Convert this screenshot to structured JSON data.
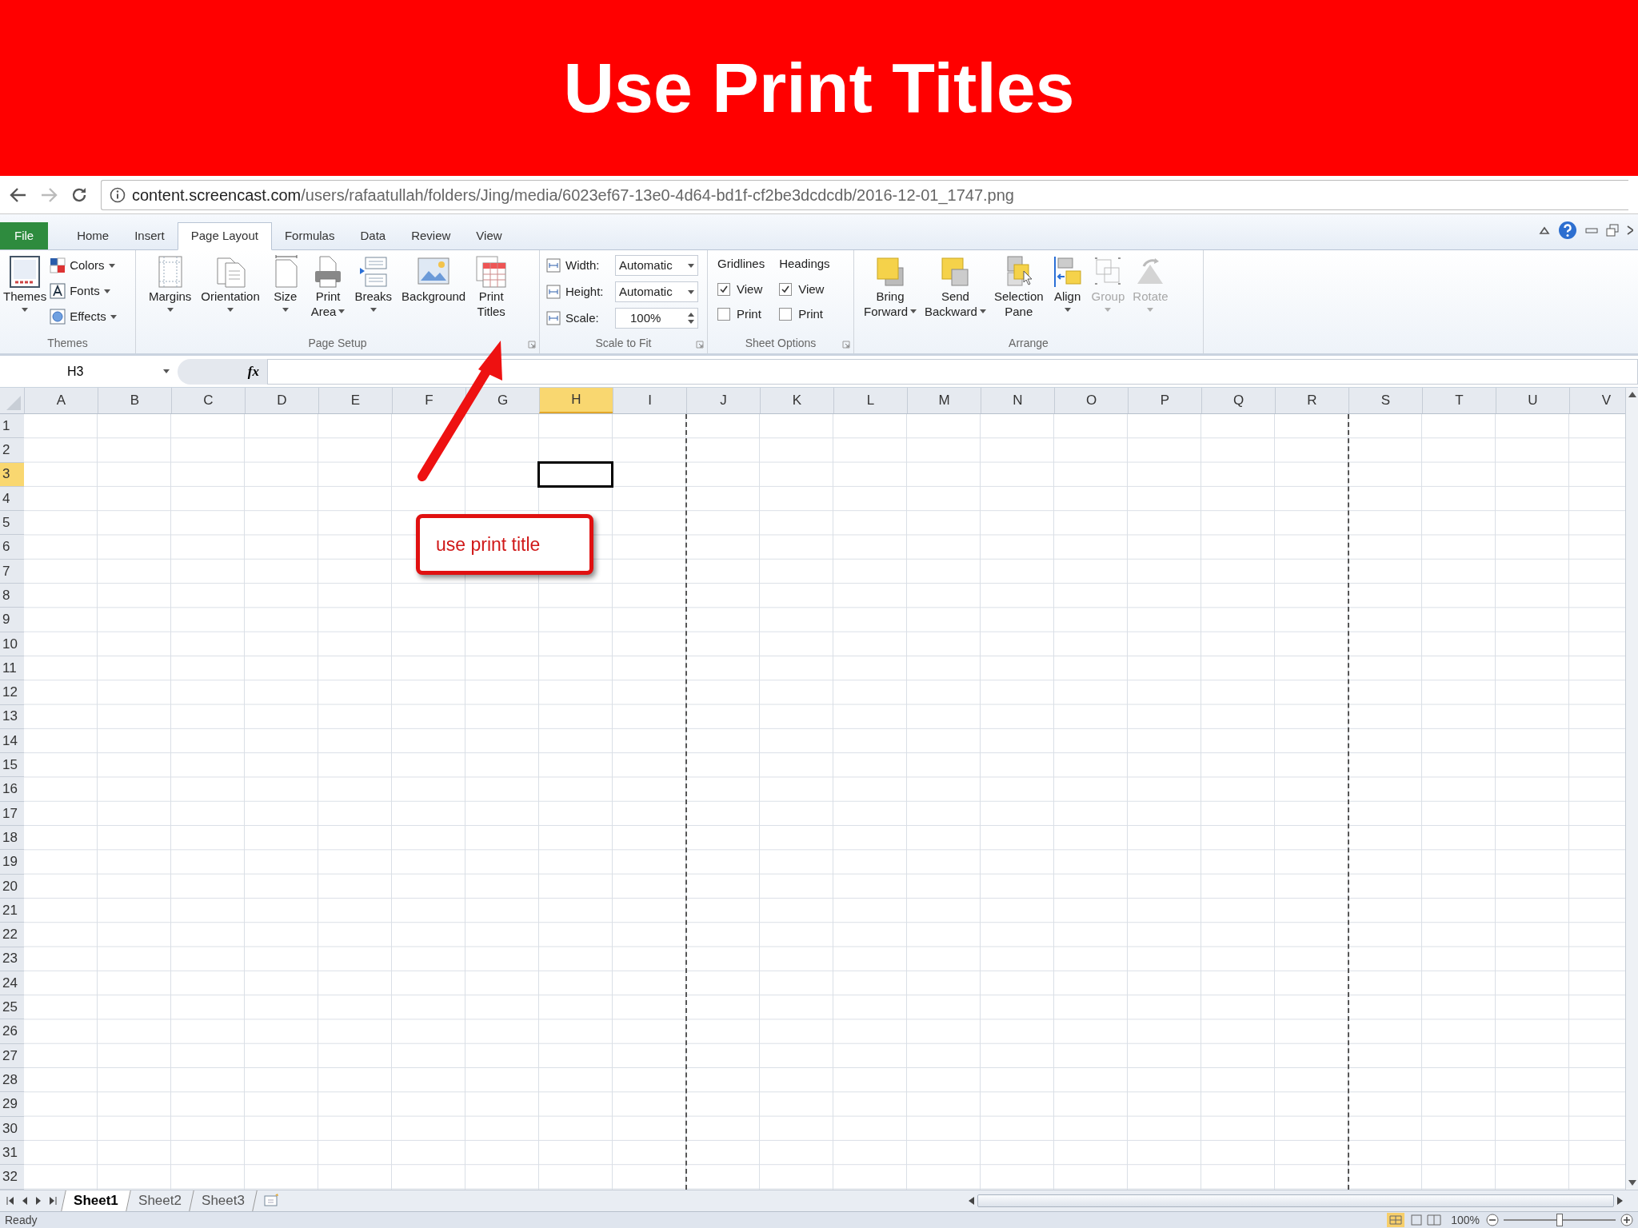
{
  "slide_title": "Use Print Titles",
  "browser": {
    "url_host": "content.screencast.com",
    "url_path": "/users/rafaatullah/folders/Jing/media/6023ef67-13e0-4d64-bd1f-cf2be3dcdcdb/2016-12-01_1747.png"
  },
  "ribbon_tabs": [
    {
      "label": "File",
      "kind": "file",
      "selected": false
    },
    {
      "label": "Home",
      "kind": "tab",
      "selected": false
    },
    {
      "label": "Insert",
      "kind": "tab",
      "selected": false
    },
    {
      "label": "Page Layout",
      "kind": "tab",
      "selected": true
    },
    {
      "label": "Formulas",
      "kind": "tab",
      "selected": false
    },
    {
      "label": "Data",
      "kind": "tab",
      "selected": false
    },
    {
      "label": "Review",
      "kind": "tab",
      "selected": false
    },
    {
      "label": "View",
      "kind": "tab",
      "selected": false
    }
  ],
  "themes_group": {
    "label": "Themes",
    "big_button": {
      "lines": [
        "Themes"
      ],
      "dropdown": true
    },
    "small_buttons": [
      {
        "label": "Colors",
        "dropdown": true
      },
      {
        "label": "Fonts",
        "dropdown": true
      },
      {
        "label": "Effects",
        "dropdown": true
      }
    ]
  },
  "page_setup_group": {
    "label": "Page Setup",
    "buttons": [
      {
        "lines": [
          "Margins"
        ],
        "dropdown": true
      },
      {
        "lines": [
          "Orientation"
        ],
        "dropdown": true
      },
      {
        "lines": [
          "Size"
        ],
        "dropdown": true
      },
      {
        "lines": [
          "Print",
          "Area"
        ],
        "dropdown": true
      },
      {
        "lines": [
          "Breaks"
        ],
        "dropdown": true
      },
      {
        "lines": [
          "Background"
        ],
        "dropdown": false
      },
      {
        "lines": [
          "Print",
          "Titles"
        ],
        "dropdown": false
      }
    ]
  },
  "scale_group": {
    "label": "Scale to Fit",
    "fields": [
      {
        "label": "Width:",
        "value": "Automatic",
        "kind": "dropdown"
      },
      {
        "label": "Height:",
        "value": "Automatic",
        "kind": "dropdown"
      },
      {
        "label": "Scale:",
        "value": "100%",
        "kind": "spinner"
      }
    ]
  },
  "sheet_options_group": {
    "label": "Sheet Options",
    "sections": [
      {
        "heading": "Gridlines",
        "options": [
          {
            "label": "View",
            "checked": true
          },
          {
            "label": "Print",
            "checked": false
          }
        ]
      },
      {
        "heading": "Headings",
        "options": [
          {
            "label": "View",
            "checked": true
          },
          {
            "label": "Print",
            "checked": false
          }
        ]
      }
    ]
  },
  "arrange_group": {
    "label": "Arrange",
    "buttons": [
      {
        "lines": [
          "Bring",
          "Forward"
        ],
        "dropdown": true,
        "disabled": false
      },
      {
        "lines": [
          "Send",
          "Backward"
        ],
        "dropdown": true,
        "disabled": false
      },
      {
        "lines": [
          "Selection",
          "Pane"
        ],
        "dropdown": false,
        "disabled": false
      },
      {
        "lines": [
          "Align"
        ],
        "dropdown": true,
        "disabled": false
      },
      {
        "lines": [
          "Group"
        ],
        "dropdown": true,
        "disabled": true
      },
      {
        "lines": [
          "Rotate"
        ],
        "dropdown": true,
        "disabled": true
      }
    ]
  },
  "formula_bar": {
    "name_box": "H3",
    "function_label": "fx"
  },
  "columns": [
    {
      "label": "A",
      "selected": false,
      "page_break": false
    },
    {
      "label": "B",
      "selected": false,
      "page_break": false
    },
    {
      "label": "C",
      "selected": false,
      "page_break": false
    },
    {
      "label": "D",
      "selected": false,
      "page_break": false
    },
    {
      "label": "E",
      "selected": false,
      "page_break": false
    },
    {
      "label": "F",
      "selected": false,
      "page_break": false
    },
    {
      "label": "G",
      "selected": false,
      "page_break": false
    },
    {
      "label": "H",
      "selected": true,
      "page_break": false
    },
    {
      "label": "I",
      "selected": false,
      "page_break": true
    },
    {
      "label": "J",
      "selected": false,
      "page_break": false
    },
    {
      "label": "K",
      "selected": false,
      "page_break": false
    },
    {
      "label": "L",
      "selected": false,
      "page_break": false
    },
    {
      "label": "M",
      "selected": false,
      "page_break": false
    },
    {
      "label": "N",
      "selected": false,
      "page_break": false
    },
    {
      "label": "O",
      "selected": false,
      "page_break": false
    },
    {
      "label": "P",
      "selected": false,
      "page_break": false
    },
    {
      "label": "Q",
      "selected": false,
      "page_break": false
    },
    {
      "label": "R",
      "selected": false,
      "page_break": true
    },
    {
      "label": "S",
      "selected": false,
      "page_break": false
    },
    {
      "label": "T",
      "selected": false,
      "page_break": false
    },
    {
      "label": "U",
      "selected": false,
      "page_break": false
    },
    {
      "label": "V",
      "selected": false,
      "page_break": false
    }
  ],
  "rows": [
    {
      "label": "1",
      "selected": false
    },
    {
      "label": "2",
      "selected": false
    },
    {
      "label": "3",
      "selected": true
    },
    {
      "label": "4",
      "selected": false
    },
    {
      "label": "5",
      "selected": false
    },
    {
      "label": "6",
      "selected": false
    },
    {
      "label": "7",
      "selected": false
    },
    {
      "label": "8",
      "selected": false
    },
    {
      "label": "9",
      "selected": false
    },
    {
      "label": "10",
      "selected": false
    },
    {
      "label": "11",
      "selected": false
    },
    {
      "label": "12",
      "selected": false
    },
    {
      "label": "13",
      "selected": false
    },
    {
      "label": "14",
      "selected": false
    },
    {
      "label": "15",
      "selected": false
    },
    {
      "label": "16",
      "selected": false
    },
    {
      "label": "17",
      "selected": false
    },
    {
      "label": "18",
      "selected": false
    },
    {
      "label": "19",
      "selected": false
    },
    {
      "label": "20",
      "selected": false
    },
    {
      "label": "21",
      "selected": false
    },
    {
      "label": "22",
      "selected": false
    },
    {
      "label": "23",
      "selected": false
    },
    {
      "label": "24",
      "selected": false
    },
    {
      "label": "25",
      "selected": false
    },
    {
      "label": "26",
      "selected": false
    },
    {
      "label": "27",
      "selected": false
    },
    {
      "label": "28",
      "selected": false
    },
    {
      "label": "29",
      "selected": false
    },
    {
      "label": "30",
      "selected": false
    },
    {
      "label": "31",
      "selected": false
    },
    {
      "label": "32",
      "selected": false
    }
  ],
  "callout": {
    "text": "use print title"
  },
  "sheet_tabs": [
    {
      "label": "Sheet1",
      "selected": true
    },
    {
      "label": "Sheet2",
      "selected": false
    },
    {
      "label": "Sheet3",
      "selected": false
    }
  ],
  "status_bar": {
    "text": "Ready",
    "zoom": "100%",
    "zoom_slider": {
      "level": 0.5
    }
  }
}
